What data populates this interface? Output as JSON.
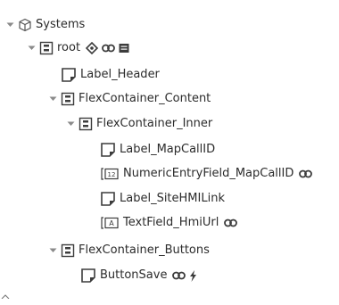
{
  "tree": {
    "systems": "Systems",
    "root": "root",
    "label_header": "Label_Header",
    "flex_content": "FlexContainer_Content",
    "flex_inner": "FlexContainer_Inner",
    "label_mapcallid": "Label_MapCallID",
    "numeric_mapcallid": "NumericEntryField_MapCallID",
    "label_sitehmilink": "Label_SiteHMILink",
    "textfield_hmiurl": "TextField_HmiUrl",
    "flex_buttons": "FlexContainer_Buttons",
    "button_save": "ButtonSave"
  },
  "icons": {
    "expanded": "chevron-down-icon",
    "systems": "cube-icon",
    "container": "flex-container-icon",
    "label": "label-icon",
    "numeric": "numeric-entry-icon",
    "textfield": "text-field-icon",
    "binding": "link-icon",
    "style": "style-icon",
    "script": "script-icon",
    "event": "lightning-icon"
  },
  "colors": {
    "text": "#2b2b2b",
    "icon": "#3c3c3c",
    "chevron": "#8a8a8a"
  }
}
